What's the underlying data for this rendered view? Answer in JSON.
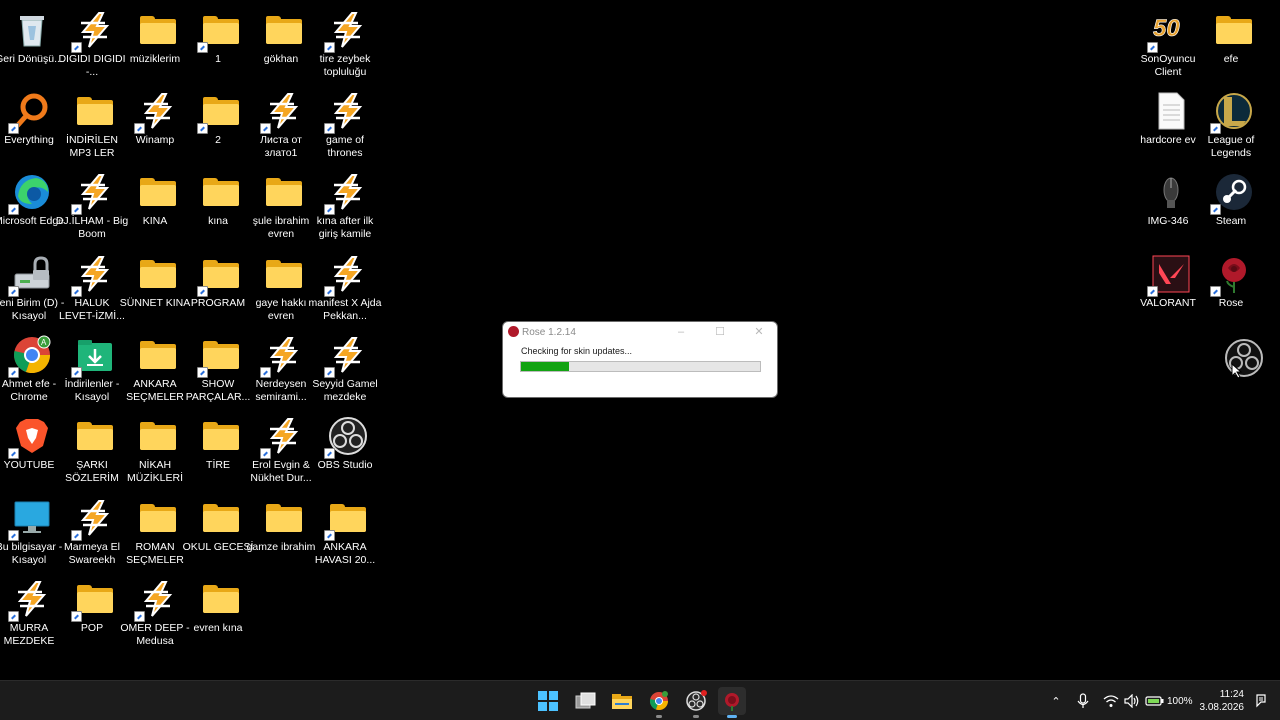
{
  "desktop": {
    "icons": [
      {
        "label": "Geri Dönüşü...",
        "type": "recycle-bin"
      },
      {
        "label": "DIGIDI DIGIDI -...",
        "type": "winamp"
      },
      {
        "label": "müziklerim",
        "type": "folder"
      },
      {
        "label": "1",
        "type": "folder"
      },
      {
        "label": "gökhan",
        "type": "folder"
      },
      {
        "label": "tire zeybek topluluğu",
        "type": "winamp"
      },
      {
        "label": "Everything",
        "type": "search-app"
      },
      {
        "label": "İNDİRİLEN MP3 LER",
        "type": "folder"
      },
      {
        "label": "Winamp",
        "type": "winamp"
      },
      {
        "label": "2",
        "type": "folder"
      },
      {
        "label": "Листа от злато1",
        "type": "winamp"
      },
      {
        "label": "game of thrones",
        "type": "winamp"
      },
      {
        "label": "Microsoft Edge",
        "type": "edge"
      },
      {
        "label": "DJ.İLHAM - Big Boom",
        "type": "winamp"
      },
      {
        "label": "KINA",
        "type": "folder"
      },
      {
        "label": "kına",
        "type": "folder"
      },
      {
        "label": "şule ibrahim evren",
        "type": "folder"
      },
      {
        "label": "kına after ilk giriş kamile",
        "type": "winamp"
      },
      {
        "label": "Yeni Birim (D) - Kısayol",
        "type": "drive"
      },
      {
        "label": "HALUK LEVET-İZMİ...",
        "type": "winamp"
      },
      {
        "label": "SÜNNET KINA",
        "type": "folder"
      },
      {
        "label": "PROGRAM",
        "type": "folder"
      },
      {
        "label": "gaye hakkı evren",
        "type": "folder"
      },
      {
        "label": "manifest X Ajda Pekkan...",
        "type": "winamp"
      },
      {
        "label": "Ahmet efe - Chrome",
        "type": "chrome"
      },
      {
        "label": "İndirilenler - Kısayol",
        "type": "downloads"
      },
      {
        "label": "ANKARA SEÇMELER",
        "type": "folder"
      },
      {
        "label": "SHOW PARÇALAR...",
        "type": "folder"
      },
      {
        "label": "Nerdeysen semirami...",
        "type": "winamp"
      },
      {
        "label": "Seyyid Gamel mezdeke",
        "type": "winamp"
      },
      {
        "label": "YOUTUBE",
        "type": "brave"
      },
      {
        "label": "ŞARKI SÖZLERİM",
        "type": "folder"
      },
      {
        "label": "NİKAH MÜZİKLERİ",
        "type": "folder"
      },
      {
        "label": "TİRE",
        "type": "folder"
      },
      {
        "label": "Erol Evgin & Nükhet Dur...",
        "type": "winamp"
      },
      {
        "label": "OBS Studio",
        "type": "obs"
      },
      {
        "label": "Bu bilgisayar - Kısayol",
        "type": "monitor"
      },
      {
        "label": "Marmeya El Swareekh",
        "type": "winamp"
      },
      {
        "label": "ROMAN SEÇMELER",
        "type": "folder"
      },
      {
        "label": "OKUL GECESİ",
        "type": "folder"
      },
      {
        "label": "gamze ibrahim",
        "type": "folder"
      },
      {
        "label": "ANKARA HAVASI 20...",
        "type": "folder"
      },
      {
        "label": "MURRA MEZDEKE",
        "type": "winamp"
      },
      {
        "label": "POP",
        "type": "folder"
      },
      {
        "label": "OMER DEEP - Medusa",
        "type": "winamp"
      },
      {
        "label": "evren kına",
        "type": "folder"
      },
      {
        "label": "SonOyuncu Client",
        "type": "sonoyuncu"
      },
      {
        "label": "efe",
        "type": "folder"
      },
      {
        "label": "hardcore ev",
        "type": "document"
      },
      {
        "label": "League of Legends",
        "type": "lol"
      },
      {
        "label": "IMG-346",
        "type": "image"
      },
      {
        "label": "Steam",
        "type": "steam"
      },
      {
        "label": "VALORANT",
        "type": "valorant"
      },
      {
        "label": "Rose",
        "type": "rose"
      },
      {
        "label": "",
        "type": "obs-dragging"
      }
    ]
  },
  "dialog": {
    "title": "Rose 1.2.14",
    "message": "Checking for skin updates...",
    "progress": 0.2,
    "minimize": "–",
    "maximize": "☐",
    "close": "✕"
  },
  "taskbar": {
    "apps": [
      "start-icon",
      "task-view-icon",
      "file-explorer-icon",
      "chrome-icon",
      "obs-icon",
      "rose-icon"
    ],
    "battery": "100%",
    "time": "11:24",
    "date": "3.08.2026"
  },
  "colors": {
    "folder_front": "#ffd55c",
    "folder_back": "#e8a817",
    "progress_fill": "#12a312",
    "taskbar_bg": "#1c1c1c"
  }
}
